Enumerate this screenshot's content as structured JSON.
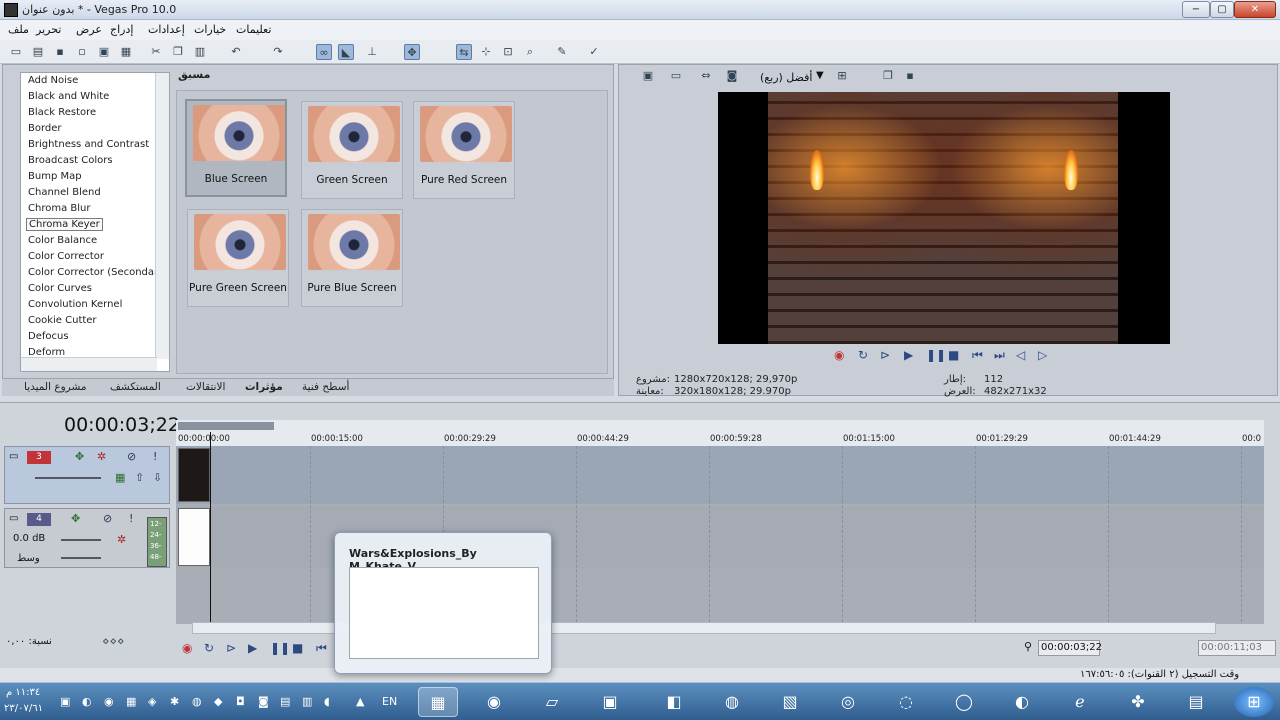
{
  "window": {
    "title": "بدون عنوان * - Vegas Pro 10.0",
    "minimize": "−",
    "maximize": "▢",
    "close": "✕"
  },
  "menu": [
    "ملف",
    "تحرير",
    "عرض",
    "إدراج",
    "إعدادات",
    "خيارات",
    "تعليمات"
  ],
  "fx_list": {
    "items": [
      "Add Noise",
      "Black and White",
      "Black Restore",
      "Border",
      "Brightness and Contrast",
      "Broadcast Colors",
      "Bump Map",
      "Channel Blend",
      "Chroma Blur",
      "Chroma Keyer",
      "Color Balance",
      "Color Corrector",
      "Color Corrector (Secondary",
      "Color Curves",
      "Convolution Kernel",
      "Cookie Cutter",
      "Defocus",
      "Deform"
    ],
    "selected_index": 9
  },
  "presets": {
    "header": "مسبق",
    "items": [
      "Blue Screen",
      "Green Screen",
      "Pure Red Screen",
      "Pure Green Screen",
      "Pure Blue Screen"
    ]
  },
  "fx_tabs": [
    "مشروع الميديا",
    "المستكشف",
    "الانتقالات",
    "مؤثرات",
    "أسطح فنية"
  ],
  "fx_tabs_active": 3,
  "preview": {
    "quality": "أفضل (ربع)",
    "project_label": "مشروع:",
    "project_value": "1280x720x128; 29,970p",
    "preview_label": "معاينة:",
    "preview_value": "320x180x128; 29.970p",
    "frame_label": "إطار:",
    "frame_value": "112",
    "display_label": "العرض:",
    "display_value": "482x271x32"
  },
  "timeline": {
    "timecode": "00:00:03;22",
    "ruler": [
      "00:00:00:00",
      "00:00:15:00",
      "00:00:29:29",
      "00:00:44:29",
      "00:00:59:28",
      "00:01:15:00",
      "00:01:29:29",
      "00:01:44:29",
      "00:0"
    ],
    "track3": {
      "number": "3"
    },
    "track4": {
      "number": "4",
      "volume": "0.0 dB",
      "pan": "وسط",
      "meters": [
        "12-",
        "24-",
        "36-",
        "48-"
      ]
    },
    "rate_label": "نسبة: ٠,٠٠",
    "cursor_time": "00:00:03;22",
    "end_time": "00:00:11;03"
  },
  "status": {
    "record_time": "وقت التسجيل (٢ القنوات): ١٦٧:٥٦:٠٥"
  },
  "taskbar_popup": {
    "title": "Wars&Explosions_By M_Khate_V..."
  },
  "taskbar": {
    "lang": "EN",
    "time": "١١:٣٤ م",
    "date": "٢٣/٠٧/٦١"
  },
  "colors": {
    "accent": "#3f6fb0",
    "track3_num_bg": "#c0343a",
    "track4_num_bg": "#5a5a8a",
    "selected_tab": "#000000"
  }
}
